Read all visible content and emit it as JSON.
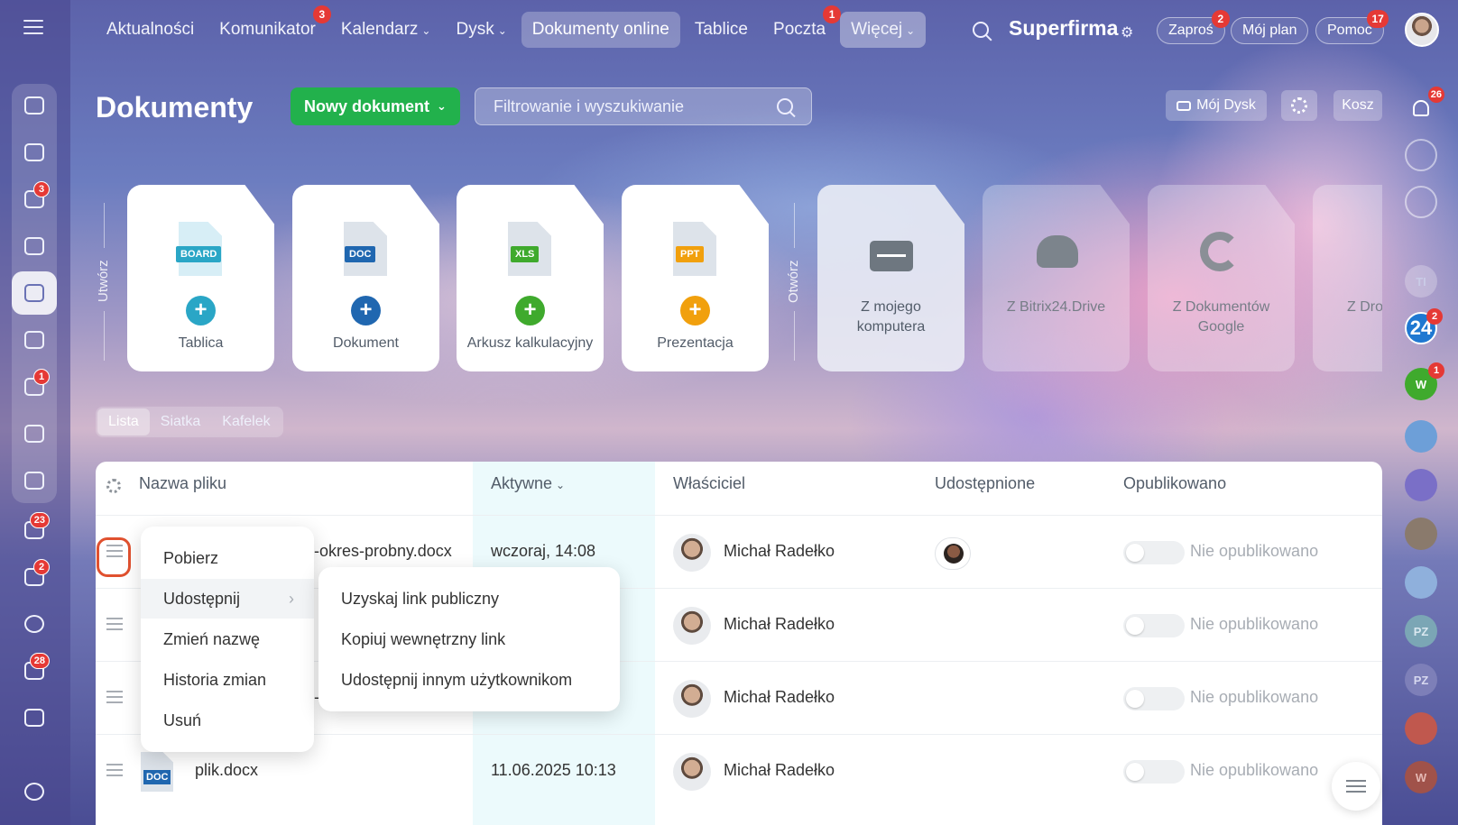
{
  "nav": {
    "items": [
      {
        "label": "Aktualności"
      },
      {
        "label": "Komunikator",
        "badge": "3"
      },
      {
        "label": "Kalendarz",
        "chevron": "⌄"
      },
      {
        "label": "Dysk",
        "chevron": "⌄"
      },
      {
        "label": "Dokumenty online",
        "active": true
      },
      {
        "label": "Tablice"
      },
      {
        "label": "Poczta",
        "badge": "1"
      },
      {
        "label": "Więcej",
        "chevron": "⌄"
      }
    ],
    "brand": "Superfirma",
    "invite": {
      "label": "Zaproś",
      "badge": "2"
    },
    "plan": "Mój plan",
    "help": {
      "label": "Pomoc",
      "badge": "17"
    }
  },
  "left_sidebar": {
    "badges": {
      "chat": "3",
      "mail": "1",
      "tasks": "23",
      "crm": "2",
      "automation": "28"
    }
  },
  "header": {
    "title": "Dokumenty",
    "new_button": "Nowy dokument",
    "search_placeholder": "Filtrowanie i wyszukiwanie",
    "my_disk": "Mój Dysk",
    "trash": "Kosz"
  },
  "right_sidebar": {
    "notifications_badge": "26",
    "b24_label": "24",
    "b24_badge": "2",
    "w_label": "W",
    "w_badge": "1",
    "ti": "TI",
    "pz1": "PZ",
    "pz2": "PZ",
    "w2": "W"
  },
  "create": {
    "label": "Utwórz",
    "cards": [
      {
        "tag": "BOARD",
        "label": "Tablica",
        "color": "#2aa6c6"
      },
      {
        "tag": "DOC",
        "label": "Dokument",
        "color": "#2067b0"
      },
      {
        "tag": "XLS",
        "label": "Arkusz kalkulacyjny",
        "color": "#3faa2d"
      },
      {
        "tag": "PPT",
        "label": "Prezentacja",
        "color": "#f1a00d"
      }
    ]
  },
  "open": {
    "label": "Otwórz",
    "cards": [
      {
        "label": "Z mojego komputera"
      },
      {
        "label": "Z Bitrix24.Drive"
      },
      {
        "label": "Z Dokumentów Google"
      },
      {
        "label": "Z Dro"
      }
    ]
  },
  "view_tabs": [
    "Lista",
    "Siatka",
    "Kafelek"
  ],
  "table": {
    "columns": {
      "name": "Nazwa pliku",
      "active": "Aktywne",
      "owner": "Właściciel",
      "shared": "Udostępnione",
      "published": "Opublikowano"
    },
    "rows": [
      {
        "name": "-okres-probny.docx",
        "date": "wczoraj, 14:08",
        "owner": "Michał Radełko",
        "status": "Nie opublikowano"
      },
      {
        "name": "",
        "date": "",
        "owner": "Michał Radełko",
        "status": "Nie opublikowano"
      },
      {
        "name": "-c",
        "date": "",
        "owner": "Michał Radełko",
        "status": "Nie opublikowano"
      },
      {
        "name": "plik.docx",
        "date": "11.06.2025 10:13",
        "owner": "Michał Radełko",
        "status": "Nie opublikowano",
        "doc_tag": "DOC"
      }
    ]
  },
  "context_menu": {
    "items": [
      "Pobierz",
      "Udostępnij",
      "Zmień nazwę",
      "Historia zmian",
      "Usuń"
    ],
    "submenu": [
      "Uzyskaj link publiczny",
      "Kopiuj wewnętrzny link",
      "Udostępnij innym użytkownikom"
    ]
  }
}
